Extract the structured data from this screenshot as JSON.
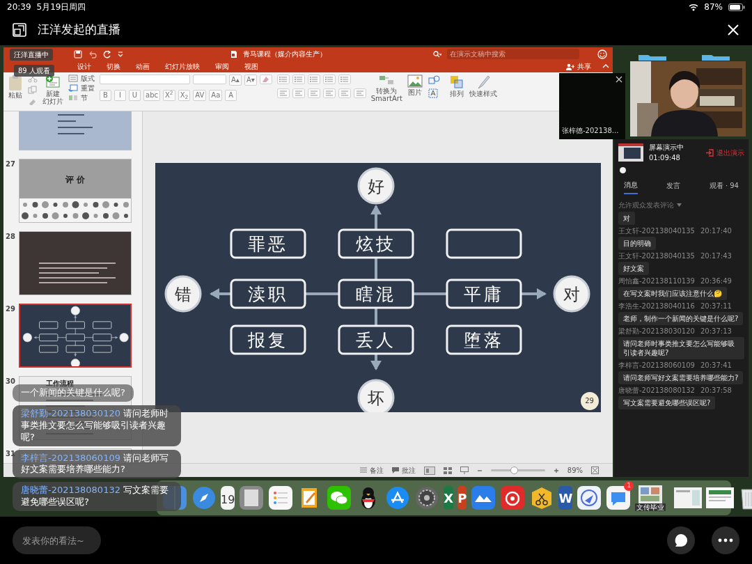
{
  "status_bar": {
    "time": "20:39",
    "date": "5月19日周四",
    "battery": "87%"
  },
  "header": {
    "title": "汪洋发起的直播"
  },
  "live_badge": "汪洋直播中",
  "viewers": "89 人观看",
  "ppt": {
    "title": "青马课程（媒介内容生产）",
    "search": {
      "placeholder": "在演示文稿中搜索"
    },
    "share": "共享",
    "tabs": [
      {
        "label": "设计",
        "selected": false
      },
      {
        "label": "切换",
        "selected": false
      },
      {
        "label": "动画",
        "selected": false
      },
      {
        "label": "幻灯片放映",
        "selected": false
      },
      {
        "label": "审阅",
        "selected": false
      },
      {
        "label": "视图",
        "selected": false
      }
    ],
    "ribbon": {
      "paste": "粘贴",
      "new_slide": [
        "新建",
        "幻灯片"
      ],
      "layout": "版式",
      "reset": "重置",
      "section": "节",
      "grow_shrink": [
        "A▴",
        "A▾"
      ],
      "format": [
        "B",
        "I",
        "U",
        "abc",
        "X$^{2}$",
        "X$_{2}$",
        "AV",
        "Aa",
        "A"
      ],
      "smartart": [
        "转换为",
        "SmartArt"
      ],
      "picture": "图片",
      "arrange": "排列",
      "quick_styles": "快速样式"
    },
    "thumbnails": [
      {
        "kind": "text_light",
        "selected": false
      },
      {
        "number": "27",
        "kind": "title",
        "title": "评 价",
        "selected": false
      },
      {
        "number": "28",
        "kind": "text_dark",
        "selected": false
      },
      {
        "number": "29",
        "kind": "diagram",
        "selected": true
      },
      {
        "number": "30",
        "kind": "list",
        "title": "工作流程",
        "selected": false
      },
      {
        "number": "31",
        "kind": "blank",
        "selected": false
      }
    ],
    "slide": {
      "page": "29",
      "poles": {
        "top": "好",
        "bottom": "坏",
        "left": "错",
        "right": "对"
      },
      "cells": [
        {
          "kind": "term",
          "label": "罪恶"
        },
        {
          "kind": "term",
          "label": "炫技"
        },
        {
          "kind": "blank"
        },
        {
          "kind": "term",
          "label": "渎职"
        },
        {
          "kind": "term",
          "label": "瞎混"
        },
        {
          "kind": "term",
          "label": "平庸"
        },
        {
          "kind": "term",
          "label": "报复"
        },
        {
          "kind": "term",
          "label": "丢人"
        },
        {
          "kind": "term",
          "label": "堕落"
        }
      ]
    },
    "status": {
      "notes": "备注",
      "comments": "批注",
      "zoom": {
        "level": 0.42,
        "reading": "89%"
      }
    }
  },
  "video_tile": {
    "name": "张梓德-202138..."
  },
  "side_panel": {
    "status": "屏幕演示中",
    "elapsed": "01:09:48",
    "exit": "退出演示",
    "tabs": [
      {
        "label": "消息",
        "selected": true
      },
      {
        "label": "发言",
        "selected": false
      },
      {
        "label": "观看 · 94",
        "selected": false
      }
    ],
    "permission": "允许观众发表评论",
    "messages": [
      {
        "text": "对"
      },
      {
        "name": "王文轩-202138040135",
        "time": "20:17:40",
        "text": "目的明确"
      },
      {
        "name": "王文轩-202138040135",
        "time": "20:17:43",
        "text": "好文案"
      },
      {
        "name": "周怡鑫-202138110139",
        "time": "20:36:49",
        "text": "在写文案时我们应该注意什么🤔"
      },
      {
        "name": "李浩生-202138040116",
        "time": "20:37:11",
        "text": "老师，制作一个新闻的关键是什么呢?"
      },
      {
        "name": "梁舒勤-202138030120",
        "time": "20:37:13",
        "text": "请问老师时事类推文要怎么写能够吸引读者兴趣呢?"
      },
      {
        "name": "李梓言-202138060109",
        "time": "20:37:41",
        "text": "请问老师写好文案需要培养哪些能力?"
      },
      {
        "name": "唐晓蕾-202138080132",
        "time": "20:37:58",
        "text": "写文案需要避免哪些误区呢?"
      }
    ]
  },
  "dock": {
    "calendar_day": "19",
    "icon_letters": [
      "X",
      "P",
      "W"
    ],
    "chat_badge": "1",
    "thumbnail_label": "文传毕业"
  },
  "overlay_comments": [
    {
      "text": "一个新闻的关键是什么呢?"
    },
    {
      "name": "梁舒勤-202138030120",
      "text": "请问老师时事类推文要怎么写能够吸引读者兴趣呢?"
    },
    {
      "name": "李梓言-202138060109",
      "text": "请问老师写好文案需要培养哪些能力?"
    },
    {
      "name": "唐晓蕾-202138080132",
      "text": "写文案需要避免哪些误区呢?"
    }
  ],
  "comment_field": {
    "placeholder": "发表你的看法~"
  }
}
